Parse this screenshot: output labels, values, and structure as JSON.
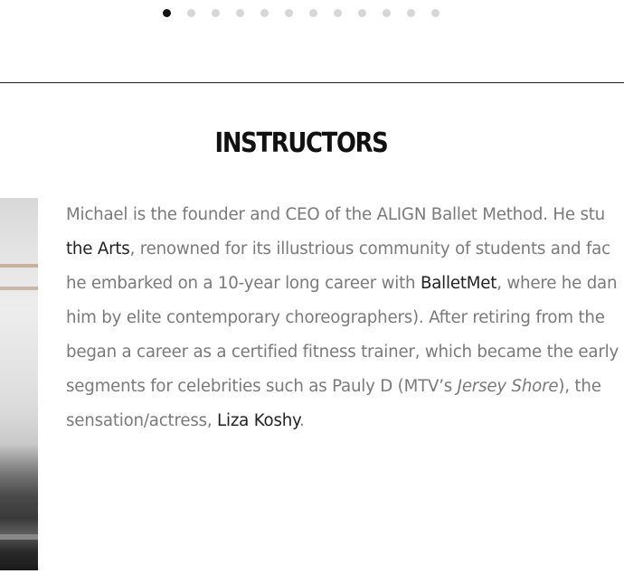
{
  "carousel": {
    "dot_count": 12,
    "active_index": 0
  },
  "section": {
    "heading": "INSTRUCTORS"
  },
  "bio": {
    "l1_text": "Michael is the founder and CEO of the ALIGN Ballet Method. He stu",
    "l2_link": "the Arts",
    "l2_text": ", renowned for its illustrious community of students and fac",
    "l3_text_a": "he embarked on a 10-year long career with ",
    "l3_link": "BalletMet",
    "l3_text_b": ", where he dan",
    "l4_text": "him by elite contemporary choreographers). After retiring from the",
    "l5_text": "began a career as a certified fitness trainer, which became the early",
    "l6_text_a": "segments for celebrities such as Pauly D (MTV’s ",
    "l6_em": "Jersey Shore",
    "l6_text_b": "), the",
    "l7_text_a": "sensation/actress, ",
    "l7_link": "Liza Koshy",
    "l7_text_b": "."
  },
  "colors": {
    "heading": "#111111",
    "body_text": "#7a7a7a",
    "link_text": "#222222",
    "dot_active": "#111111",
    "dot_inactive": "#d6d6d6"
  }
}
